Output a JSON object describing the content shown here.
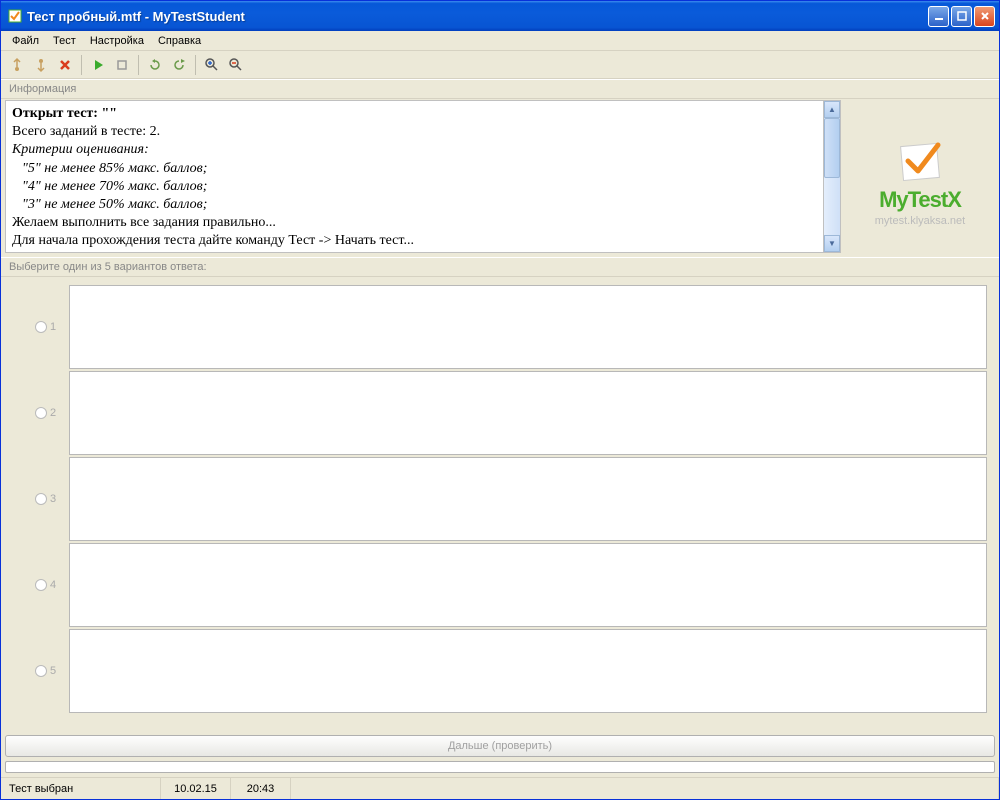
{
  "title": "Тест пробный.mtf - MyTestStudent",
  "menu": {
    "file": "Файл",
    "test": "Тест",
    "settings": "Настройка",
    "help": "Справка"
  },
  "panels": {
    "info_label": "Информация",
    "question_label": "Выберите один из 5 вариантов ответа:"
  },
  "info": {
    "opened": "Открыт тест: \"\"",
    "total": "Всего заданий в тесте: 2.",
    "criteria": "Критерии оценивания:",
    "c5": "\"5\" не менее 85% макс. баллов;",
    "c4": "\"4\" не менее 70% макс. баллов;",
    "c3": "\"3\" не менее 50% макс. баллов;",
    "wish": "Желаем выполнить все задания правильно...",
    "start": "Для начала прохождения теста дайте команду Тест -> Начать тест..."
  },
  "logo": {
    "name": "MyTestX",
    "url": "mytest.klyaksa.net"
  },
  "answers": [
    {
      "num": "1"
    },
    {
      "num": "2"
    },
    {
      "num": "3"
    },
    {
      "num": "4"
    },
    {
      "num": "5"
    }
  ],
  "buttons": {
    "next": "Дальше (проверить)"
  },
  "status": {
    "state": "Тест выбран",
    "date": "10.02.15",
    "time": "20:43"
  },
  "colors": {
    "accent_green": "#4bad2e",
    "accent_orange": "#f08a1e"
  }
}
